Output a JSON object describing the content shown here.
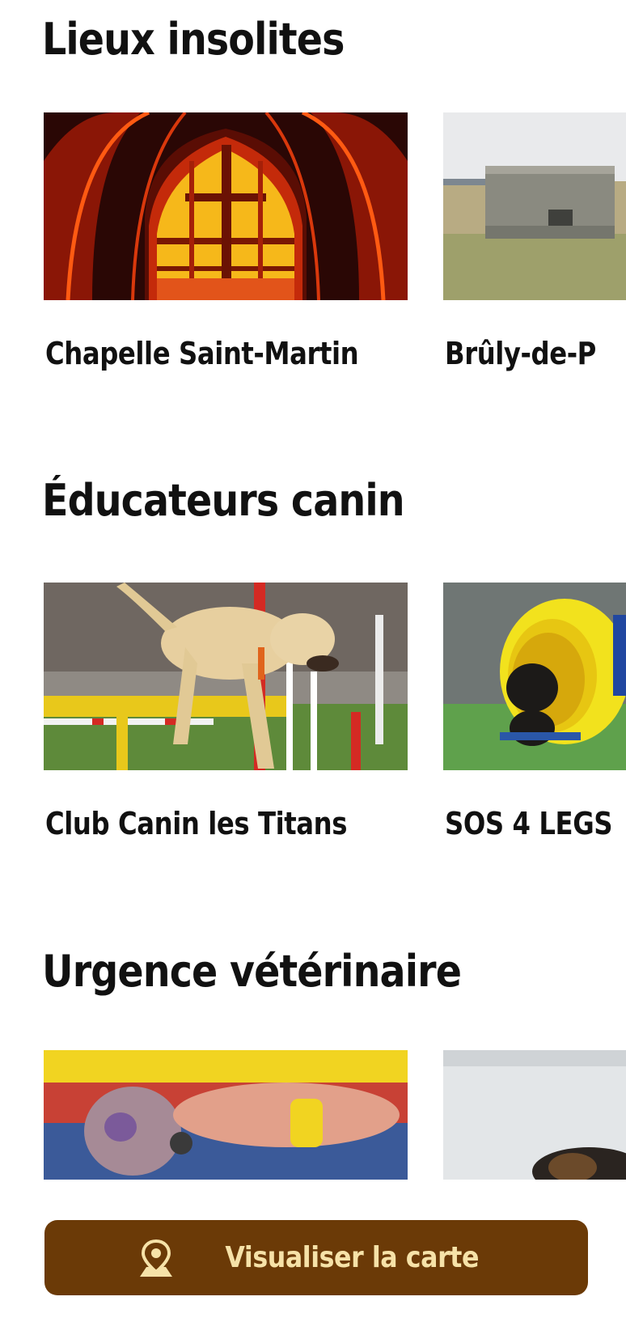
{
  "sections": [
    {
      "title": "Lieux insolites",
      "cards": [
        {
          "title": "Chapelle Saint-Martin",
          "image": "stained-glass-chapel-window"
        },
        {
          "title": "Brûly-de-P",
          "image": "concrete-bunker-field"
        }
      ]
    },
    {
      "title": "Éducateurs canin",
      "cards": [
        {
          "title": "Club Canin les Titans",
          "image": "labrador-agility-jump"
        },
        {
          "title": "SOS 4 LEGS",
          "image": "dog-in-yellow-tunnel"
        }
      ]
    },
    {
      "title": "Urgence vétérinaire",
      "cards": [
        {
          "title": "",
          "image": "vet-stethoscope-puppy"
        },
        {
          "title": "",
          "image": "dog-in-clinic"
        }
      ]
    }
  ],
  "map_button": {
    "label": "Visualiser la carte",
    "icon": "map-pin-icon",
    "background": "#6b3a07",
    "text_color": "#f6e2a8"
  }
}
